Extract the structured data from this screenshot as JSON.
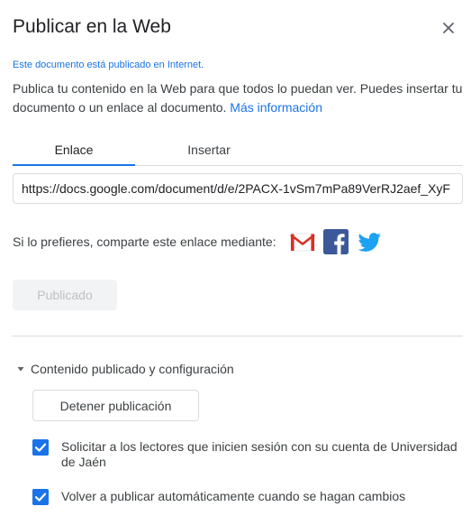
{
  "dialog": {
    "title": "Publicar en la Web",
    "status": "Este documento está publicado en Internet.",
    "description": "Publica tu contenido en la Web para que todos lo puedan ver. Puedes insertar tu documento o un enlace al documento.",
    "more_info_link": "Más información",
    "tabs": [
      {
        "label": "Enlace",
        "active": true
      },
      {
        "label": "Insertar",
        "active": false
      }
    ],
    "link_url": "https://docs.google.com/document/d/e/2PACX-1vSm7mPa89VerRJ2aef_XyF",
    "share": {
      "label": "Si lo prefieres, comparte este enlace mediante:",
      "services": [
        "gmail-icon",
        "facebook-icon",
        "twitter-icon"
      ]
    },
    "published_button": "Publicado",
    "section": {
      "label": "Contenido publicado y configuración",
      "expanded": true,
      "stop_button": "Detener publicación",
      "options": [
        {
          "label": "Solicitar a los lectores que inicien sesión con su cuenta de Universidad de Jaén",
          "checked": true
        },
        {
          "label": "Volver a publicar automáticamente cuando se hagan cambios",
          "checked": true
        }
      ]
    }
  },
  "colors": {
    "accent": "#1a73e8",
    "facebook": "#3b5998",
    "twitter": "#1da1f2",
    "gmail_red": "#d93025"
  }
}
